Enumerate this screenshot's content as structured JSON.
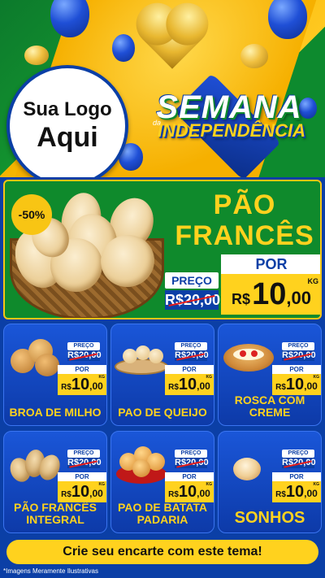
{
  "header": {
    "logo_line1": "Sua Logo",
    "logo_line2": "Aqui",
    "campaign_top": "SEMANA",
    "campaign_da": "da",
    "campaign_bottom": "INDEPENDÊNCIA"
  },
  "hero": {
    "discount": "-50%",
    "title_line1": "PÃO",
    "title_line2": "FRANCÊS",
    "preco_label": "PREÇO",
    "old_price": "R$20,00",
    "por_label": "POR",
    "currency": "R$",
    "price_int": "10",
    "price_dec": ",00",
    "unit": "KG"
  },
  "products": [
    {
      "name": "BROA DE MILHO",
      "preco_label": "PREÇO",
      "old_price": "R$20,00",
      "por_label": "POR",
      "currency": "R$",
      "price_int": "10",
      "price_dec": ",00",
      "unit": "KG"
    },
    {
      "name": "PAO DE QUEIJO",
      "preco_label": "PREÇO",
      "old_price": "R$20,00",
      "por_label": "POR",
      "currency": "R$",
      "price_int": "10",
      "price_dec": ",00",
      "unit": "KG"
    },
    {
      "name": "ROSCA COM CREME",
      "preco_label": "PREÇO",
      "old_price": "R$20,00",
      "por_label": "POR",
      "currency": "R$",
      "price_int": "10",
      "price_dec": ",00",
      "unit": "KG"
    },
    {
      "name": "PÃO FRANCÊS INTEGRAL",
      "preco_label": "PREÇO",
      "old_price": "R$20,00",
      "por_label": "POR",
      "currency": "R$",
      "price_int": "10",
      "price_dec": ",00",
      "unit": "KG"
    },
    {
      "name": "PAO DE BATATA PADARIA",
      "preco_label": "PREÇO",
      "old_price": "R$20,00",
      "por_label": "POR",
      "currency": "R$",
      "price_int": "10",
      "price_dec": ",00",
      "unit": "KG"
    },
    {
      "name": "SONHOS",
      "preco_label": "PREÇO",
      "old_price": "R$20,00",
      "por_label": "POR",
      "currency": "R$",
      "price_int": "10",
      "price_dec": ",00",
      "unit": "KG"
    }
  ],
  "footer": {
    "cta": "Crie seu encarte com este tema!",
    "disclaimer": "*Imagens Meramente Ilustrativas"
  },
  "colors": {
    "brand_blue": "#0b3fa6",
    "brand_green": "#0f8a2c",
    "brand_yellow": "#ffd21e",
    "strike_red": "#e31c1c"
  }
}
